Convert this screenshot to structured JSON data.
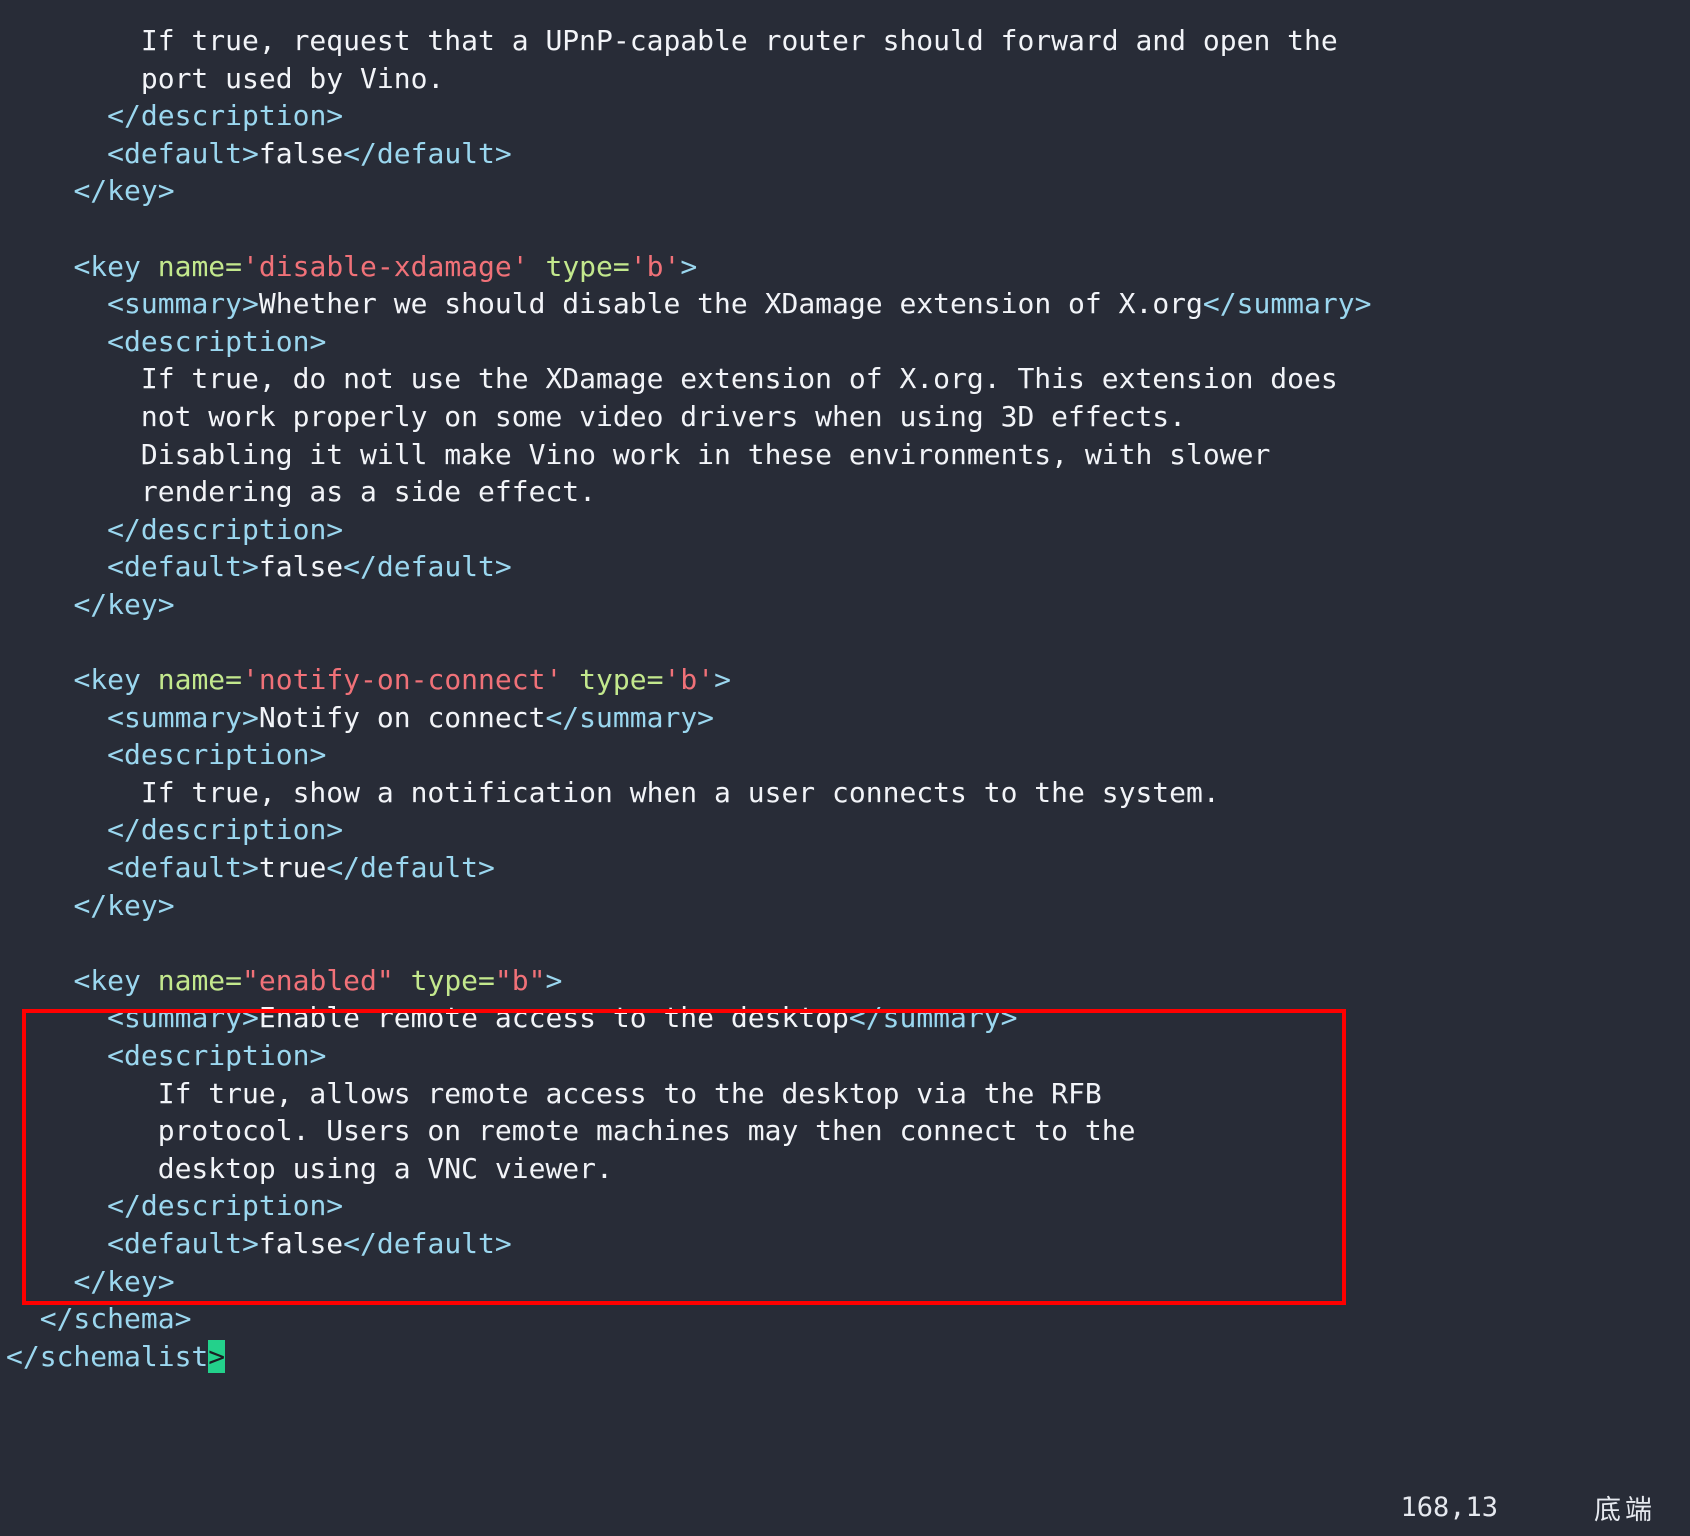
{
  "editor": {
    "type": "terminal-text-editor",
    "background_color": "#282c37",
    "foreground_color": "#e6e9ef",
    "syntax_colors": {
      "tag": "#9bd7ef",
      "attribute_name": "#c3e88d",
      "attribute_value": "#f07178",
      "text_content": "#f2f4f8",
      "cursor_background": "#23d18b",
      "annotation_box": "#ff0000"
    }
  },
  "code_lines": [
    {
      "id": "line-1",
      "indent": 4,
      "segments": [
        {
          "class": "txt",
          "text": "If true, request that a UPnP-capable router should forward and open the"
        }
      ]
    },
    {
      "id": "line-2",
      "indent": 4,
      "segments": [
        {
          "class": "txt",
          "text": "port used by Vino."
        }
      ]
    },
    {
      "id": "line-3",
      "indent": 3,
      "segments": [
        {
          "class": "tag",
          "text": "</description>"
        }
      ]
    },
    {
      "id": "line-4",
      "indent": 3,
      "segments": [
        {
          "class": "tag",
          "text": "<default>"
        },
        {
          "class": "txt",
          "text": "false"
        },
        {
          "class": "tag",
          "text": "</default>"
        }
      ]
    },
    {
      "id": "line-5",
      "indent": 2,
      "segments": [
        {
          "class": "tag",
          "text": "</key>"
        }
      ]
    },
    {
      "id": "line-6",
      "indent": 0,
      "segments": []
    },
    {
      "id": "line-7",
      "indent": 2,
      "segments": [
        {
          "class": "tag",
          "text": "<key "
        },
        {
          "class": "attr",
          "text": "name="
        },
        {
          "class": "str",
          "text": "'disable-xdamage'"
        },
        {
          "class": "attr",
          "text": " type="
        },
        {
          "class": "str",
          "text": "'b'"
        },
        {
          "class": "tag",
          "text": ">"
        }
      ]
    },
    {
      "id": "line-8",
      "indent": 3,
      "segments": [
        {
          "class": "tag",
          "text": "<summary>"
        },
        {
          "class": "txt",
          "text": "Whether we should disable the XDamage extension of X.org"
        },
        {
          "class": "tag",
          "text": "</summary>"
        }
      ]
    },
    {
      "id": "line-9",
      "indent": 3,
      "segments": [
        {
          "class": "tag",
          "text": "<description>"
        }
      ]
    },
    {
      "id": "line-10",
      "indent": 4,
      "segments": [
        {
          "class": "txt",
          "text": "If true, do not use the XDamage extension of X.org. This extension does"
        }
      ]
    },
    {
      "id": "line-11",
      "indent": 4,
      "segments": [
        {
          "class": "txt",
          "text": "not work properly on some video drivers when using 3D effects."
        }
      ]
    },
    {
      "id": "line-12",
      "indent": 4,
      "segments": [
        {
          "class": "txt",
          "text": "Disabling it will make Vino work in these environments, with slower"
        }
      ]
    },
    {
      "id": "line-13",
      "indent": 4,
      "segments": [
        {
          "class": "txt",
          "text": "rendering as a side effect."
        }
      ]
    },
    {
      "id": "line-14",
      "indent": 3,
      "segments": [
        {
          "class": "tag",
          "text": "</description>"
        }
      ]
    },
    {
      "id": "line-15",
      "indent": 3,
      "segments": [
        {
          "class": "tag",
          "text": "<default>"
        },
        {
          "class": "txt",
          "text": "false"
        },
        {
          "class": "tag",
          "text": "</default>"
        }
      ]
    },
    {
      "id": "line-16",
      "indent": 2,
      "segments": [
        {
          "class": "tag",
          "text": "</key>"
        }
      ]
    },
    {
      "id": "line-17",
      "indent": 0,
      "segments": []
    },
    {
      "id": "line-18",
      "indent": 2,
      "segments": [
        {
          "class": "tag",
          "text": "<key "
        },
        {
          "class": "attr",
          "text": "name="
        },
        {
          "class": "str",
          "text": "'notify-on-connect'"
        },
        {
          "class": "attr",
          "text": " type="
        },
        {
          "class": "str",
          "text": "'b'"
        },
        {
          "class": "tag",
          "text": ">"
        }
      ]
    },
    {
      "id": "line-19",
      "indent": 3,
      "segments": [
        {
          "class": "tag",
          "text": "<summary>"
        },
        {
          "class": "txt",
          "text": "Notify on connect"
        },
        {
          "class": "tag",
          "text": "</summary>"
        }
      ]
    },
    {
      "id": "line-20",
      "indent": 3,
      "segments": [
        {
          "class": "tag",
          "text": "<description>"
        }
      ]
    },
    {
      "id": "line-21",
      "indent": 4,
      "segments": [
        {
          "class": "txt",
          "text": "If true, show a notification when a user connects to the system."
        }
      ]
    },
    {
      "id": "line-22",
      "indent": 3,
      "segments": [
        {
          "class": "tag",
          "text": "</description>"
        }
      ]
    },
    {
      "id": "line-23",
      "indent": 3,
      "segments": [
        {
          "class": "tag",
          "text": "<default>"
        },
        {
          "class": "txt",
          "text": "true"
        },
        {
          "class": "tag",
          "text": "</default>"
        }
      ]
    },
    {
      "id": "line-24",
      "indent": 2,
      "segments": [
        {
          "class": "tag",
          "text": "</key>"
        }
      ]
    },
    {
      "id": "line-25",
      "indent": 0,
      "segments": []
    },
    {
      "id": "line-26",
      "indent": 2,
      "segments": [
        {
          "class": "tag",
          "text": "<key "
        },
        {
          "class": "attr",
          "text": "name="
        },
        {
          "class": "str",
          "text": "\"enabled\""
        },
        {
          "class": "attr",
          "text": " type="
        },
        {
          "class": "str",
          "text": "\"b\""
        },
        {
          "class": "tag",
          "text": ">"
        }
      ]
    },
    {
      "id": "line-27",
      "indent": 3,
      "segments": [
        {
          "class": "tag",
          "text": "<summary>"
        },
        {
          "class": "txt",
          "text": "Enable remote access to the desktop"
        },
        {
          "class": "tag",
          "text": "</summary>"
        }
      ]
    },
    {
      "id": "line-28",
      "indent": 3,
      "segments": [
        {
          "class": "tag",
          "text": "<description>"
        }
      ]
    },
    {
      "id": "line-29",
      "indent": 4,
      "segments": [
        {
          "class": "txt",
          "text": " If true, allows remote access to the desktop via the RFB"
        }
      ]
    },
    {
      "id": "line-30",
      "indent": 4,
      "segments": [
        {
          "class": "txt",
          "text": " protocol. Users on remote machines may then connect to the"
        }
      ]
    },
    {
      "id": "line-31",
      "indent": 4,
      "segments": [
        {
          "class": "txt",
          "text": " desktop using a VNC viewer."
        }
      ]
    },
    {
      "id": "line-32",
      "indent": 3,
      "segments": [
        {
          "class": "tag",
          "text": "</description>"
        }
      ]
    },
    {
      "id": "line-33",
      "indent": 3,
      "segments": [
        {
          "class": "tag",
          "text": "<default>"
        },
        {
          "class": "txt",
          "text": "false"
        },
        {
          "class": "tag",
          "text": "</default>"
        }
      ]
    },
    {
      "id": "line-34",
      "indent": 2,
      "segments": [
        {
          "class": "tag",
          "text": "</key>"
        }
      ]
    },
    {
      "id": "line-35",
      "indent": 1,
      "segments": [
        {
          "class": "tag",
          "text": "</schema>"
        }
      ]
    },
    {
      "id": "line-36",
      "indent": 0,
      "segments": [
        {
          "class": "tag",
          "text": "</schemalist"
        },
        {
          "class": "tag cursor",
          "text": ">"
        }
      ]
    }
  ],
  "annotation": {
    "shape": "rectangle",
    "color": "#ff0000",
    "target": "enabled key block"
  },
  "status_bar": {
    "cursor_position": "168,13",
    "file_state": "底端"
  }
}
